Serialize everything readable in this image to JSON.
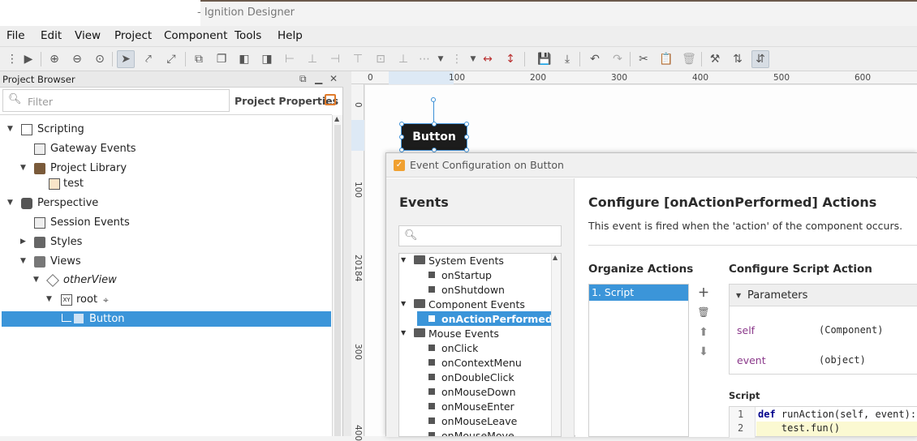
{
  "window": {
    "title": "- Ignition Designer"
  },
  "menu": [
    "File",
    "Edit",
    "View",
    "Project",
    "Component",
    "Tools",
    "Help"
  ],
  "project_browser": {
    "title": "Project Browser",
    "filter_placeholder": "Filter",
    "properties_label": "Project Properties",
    "tree": [
      {
        "label": "Scripting",
        "icon": "script-doc-icon"
      },
      {
        "label": "Gateway Events",
        "icon": "gateway-events-icon"
      },
      {
        "label": "Project Library",
        "icon": "library-icon"
      },
      {
        "label": "test",
        "icon": "script-file-icon"
      },
      {
        "label": "Perspective",
        "icon": "perspective-icon"
      },
      {
        "label": "Session Events",
        "icon": "session-events-icon"
      },
      {
        "label": "Styles",
        "icon": "styles-icon"
      },
      {
        "label": "Views",
        "icon": "views-folder-icon"
      },
      {
        "label": "otherView",
        "icon": "view-cube-icon"
      },
      {
        "label": "root",
        "icon": "xy-container-icon"
      },
      {
        "label": "Button",
        "icon": "button-component-icon"
      }
    ]
  },
  "ruler": {
    "top": [
      "0",
      "100",
      "200",
      "300",
      "400",
      "500",
      "600"
    ],
    "left": [
      "0",
      "100",
      "20184",
      "300",
      "400"
    ]
  },
  "canvas": {
    "button_label": "Button"
  },
  "dialog": {
    "title": "Event Configuration on Button",
    "events_heading": "Events",
    "event_tree": [
      {
        "label": "System Events",
        "type": "folder"
      },
      {
        "label": "onStartup",
        "type": "event"
      },
      {
        "label": "onShutdown",
        "type": "event"
      },
      {
        "label": "Component Events",
        "type": "folder"
      },
      {
        "label": "onActionPerformed*",
        "type": "event"
      },
      {
        "label": "Mouse Events",
        "type": "folder"
      },
      {
        "label": "onClick",
        "type": "event"
      },
      {
        "label": "onContextMenu",
        "type": "event"
      },
      {
        "label": "onDoubleClick",
        "type": "event"
      },
      {
        "label": "onMouseDown",
        "type": "event"
      },
      {
        "label": "onMouseEnter",
        "type": "event"
      },
      {
        "label": "onMouseLeave",
        "type": "event"
      },
      {
        "label": "onMouseMove",
        "type": "event"
      }
    ],
    "configure_heading": "Configure [onActionPerformed] Actions",
    "configure_desc": "This event is fired when the 'action' of the component occurs.",
    "organize_heading": "Organize Actions",
    "actions": [
      "1. Script"
    ],
    "script_action_heading": "Configure Script Action",
    "parameters_label": "Parameters",
    "params": [
      {
        "name": "self",
        "type": "(Component)"
      },
      {
        "name": "event",
        "type": "(object)"
      }
    ],
    "script_label": "Script",
    "code": {
      "line1_num": "1",
      "line1_kw": "def",
      "line1_rest": " runAction(self, event):",
      "line2_num": "2",
      "line2": "    test.fun()"
    }
  },
  "colors": {
    "selection": "#3b95d9",
    "accent": "#e07b2c"
  }
}
